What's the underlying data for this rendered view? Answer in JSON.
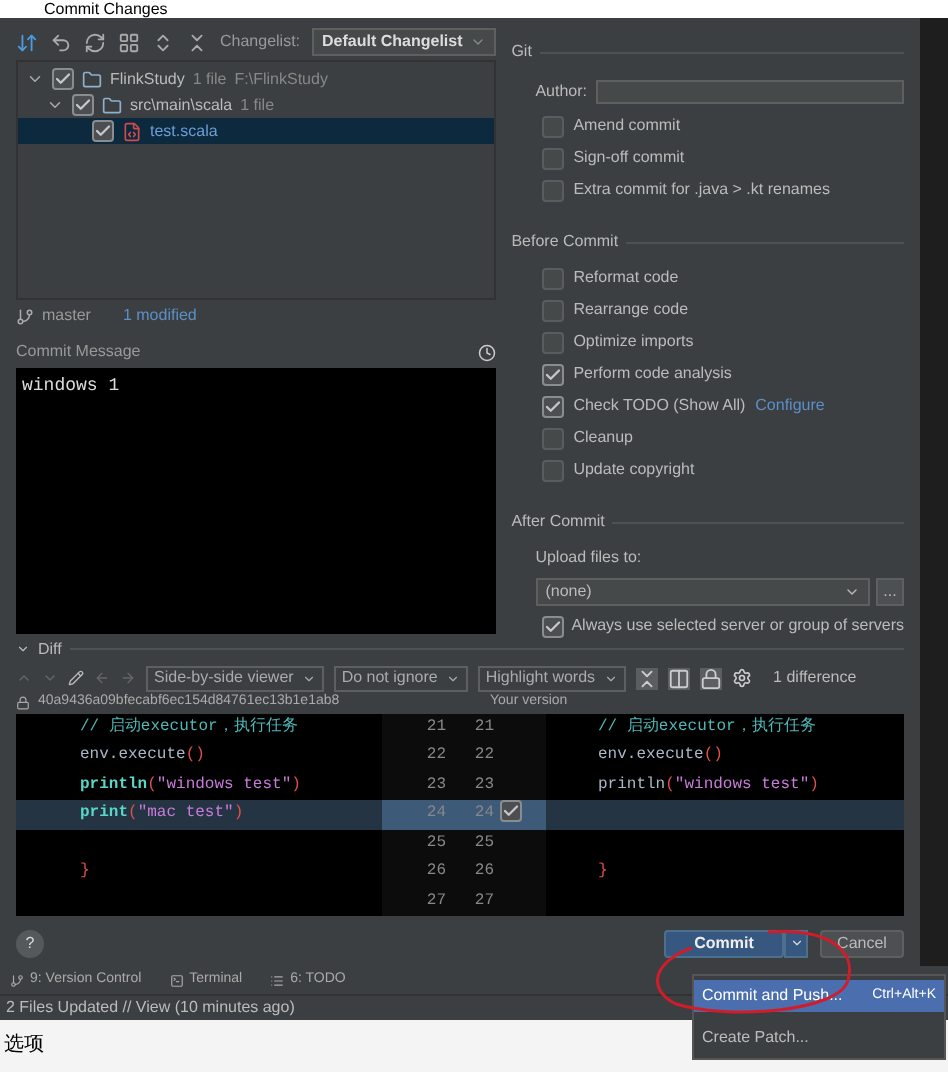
{
  "window": {
    "title": "Commit Changes"
  },
  "changelist": {
    "label": "Changelist:",
    "value": "Default Changelist"
  },
  "tree": [
    {
      "name": "FlinkStudy",
      "count": "1 file",
      "path": "F:\\FlinkStudy",
      "checked": true,
      "expanded": true,
      "selected": false,
      "children": [
        {
          "name": "src\\main\\scala",
          "count": "1 file",
          "checked": true,
          "expanded": true,
          "selected": false,
          "children": [
            {
              "name": "test.scala",
              "checked": true,
              "selected": true
            }
          ]
        }
      ]
    }
  ],
  "branch": {
    "name": "master",
    "modified": "1 modified"
  },
  "commit_message": {
    "label": "Commit Message",
    "value": "windows 1"
  },
  "git": {
    "title": "Git",
    "author_label": "Author:",
    "options": [
      {
        "label": "Amend commit",
        "checked": false
      },
      {
        "label": "Sign-off commit",
        "checked": false
      },
      {
        "label": "Extra commit for .java > .kt renames",
        "checked": false
      }
    ]
  },
  "before_commit": {
    "title": "Before Commit",
    "options": [
      {
        "label": "Reformat code",
        "checked": false
      },
      {
        "label": "Rearrange code",
        "checked": false
      },
      {
        "label": "Optimize imports",
        "checked": false
      },
      {
        "label": "Perform code analysis",
        "checked": true
      },
      {
        "label": "Check TODO (Show All)",
        "checked": true,
        "link": "Configure"
      },
      {
        "label": "Cleanup",
        "checked": false
      },
      {
        "label": "Update copyright",
        "checked": false
      }
    ]
  },
  "after_commit": {
    "title": "After Commit",
    "upload_label": "Upload files to:",
    "server": "(none)",
    "browse": "...",
    "always": {
      "label": "Always use selected server or group of servers",
      "checked": true
    }
  },
  "diff": {
    "title": "Diff",
    "viewer": "Side-by-side viewer",
    "ignore": "Do not ignore",
    "highlight": "Highlight words",
    "differences": "1 difference",
    "left_header": "40a9436a09bfecabf6ec154d84761ec13b1e1ab8",
    "right_header": "Your version",
    "lines": [
      {
        "left_num": "21",
        "right_num": "21",
        "changed": false,
        "left": [
          {
            "kind": "comment",
            "text": "// 启动executor，执行任务"
          }
        ],
        "right": [
          {
            "kind": "comment",
            "text": "// 启动executor，执行任务"
          }
        ]
      },
      {
        "left_num": "22",
        "right_num": "22",
        "changed": false,
        "left": [
          {
            "kind": "plain",
            "text": "env.execute"
          },
          {
            "kind": "paren",
            "text": "()"
          }
        ],
        "right": [
          {
            "kind": "plain",
            "text": "env.execute"
          },
          {
            "kind": "paren",
            "text": "()"
          }
        ]
      },
      {
        "left_num": "23",
        "right_num": "23",
        "changed": false,
        "left": [
          {
            "kind": "func",
            "text": "println"
          },
          {
            "kind": "paren",
            "text": "("
          },
          {
            "kind": "string",
            "text": "\"windows test\""
          },
          {
            "kind": "paren",
            "text": ")"
          }
        ],
        "right": [
          {
            "kind": "plain",
            "text": "println"
          },
          {
            "kind": "paren",
            "text": "("
          },
          {
            "kind": "string",
            "text": "\"windows test\""
          },
          {
            "kind": "paren",
            "text": ")"
          }
        ]
      },
      {
        "left_num": "24",
        "right_num": "24",
        "changed": true,
        "included": true,
        "left": [
          {
            "kind": "func",
            "text": "print"
          },
          {
            "kind": "paren",
            "text": "("
          },
          {
            "kind": "string",
            "text": "\"mac test\""
          },
          {
            "kind": "paren",
            "text": ")"
          }
        ]
      },
      {
        "left_num": "25",
        "right_num": "25",
        "changed": false
      },
      {
        "left_num": "26",
        "right_num": "26",
        "changed": false,
        "left": [
          {
            "kind": "paren",
            "text": "}"
          }
        ],
        "right": [
          {
            "kind": "paren",
            "text": "}"
          }
        ]
      },
      {
        "left_num": "27",
        "right_num": "27",
        "changed": false
      }
    ]
  },
  "buttons": {
    "help": "?",
    "commit": "Commit",
    "cancel": "Cancel"
  },
  "menu": [
    {
      "label": "Commit and Push...",
      "shortcut": "Ctrl+Alt+K",
      "selected": true
    },
    {
      "label": "Create Patch...",
      "selected": false
    }
  ],
  "tool_windows": [
    "9: Version Control",
    "Terminal",
    "6: TODO"
  ],
  "status": "2 Files Updated // View (10 minutes ago)",
  "bottom_label": "选项"
}
